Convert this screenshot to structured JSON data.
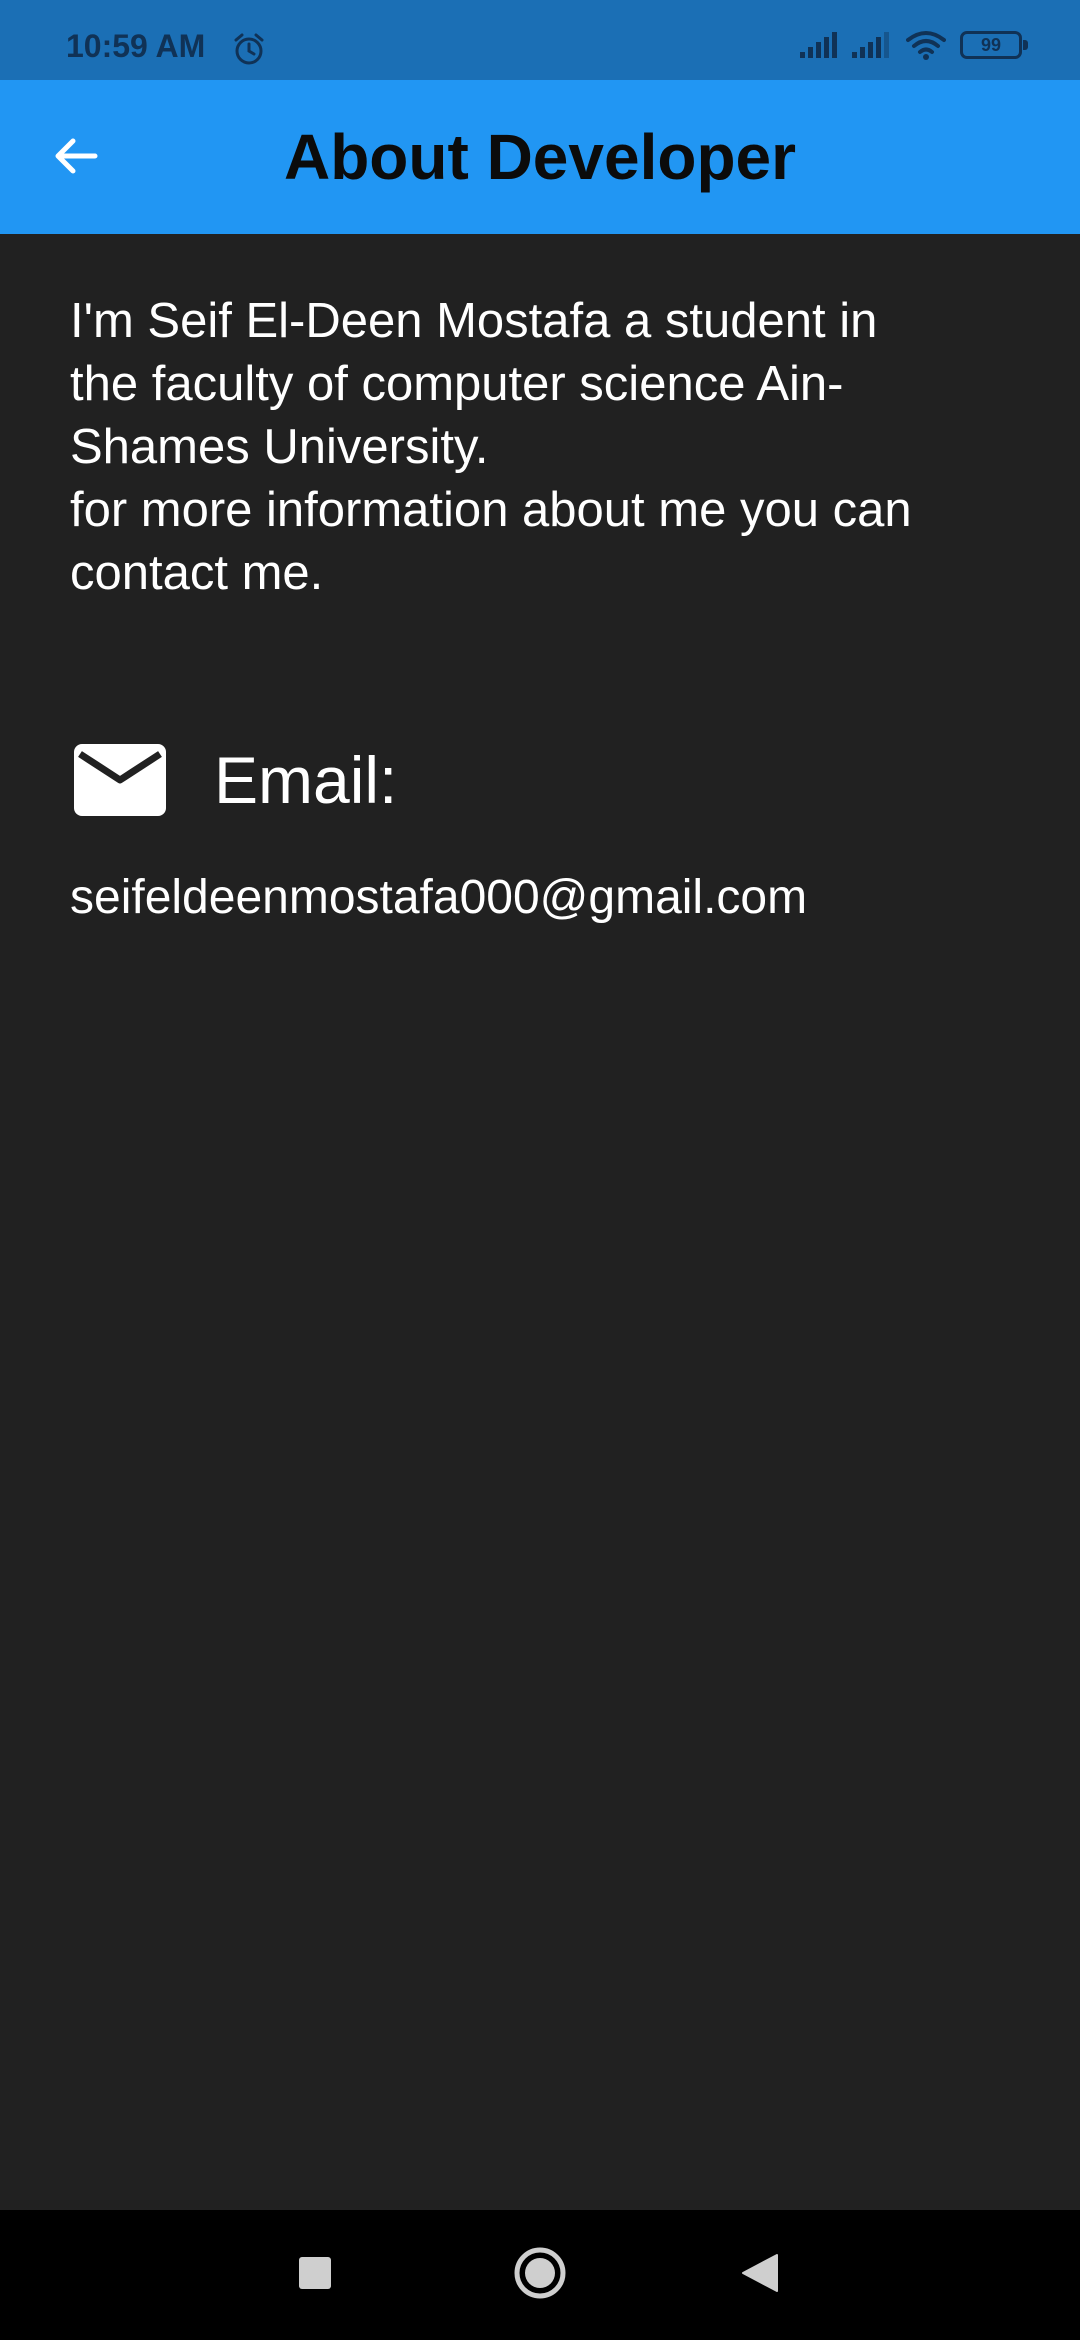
{
  "status_bar": {
    "time": "10:59 AM",
    "alarm_icon": "alarm-clock-icon",
    "signal_icons": [
      "signal-icon",
      "signal-icon"
    ],
    "wifi_icon": "wifi-icon",
    "battery_level": "99"
  },
  "app_bar": {
    "back_icon": "arrow-back-icon",
    "title": "About Developer",
    "color": "#2196f3"
  },
  "bio": {
    "lines": [
      "I'm Seif El-Deen Mostafa a student in",
      "the faculty of computer science Ain-",
      "Shames University.",
      "for more information about me you can",
      "contact me."
    ]
  },
  "email": {
    "icon": "mail-icon",
    "label": "Email:",
    "address": "seifeldeenmostafa000@gmail.com"
  },
  "nav_bar": {
    "buttons": [
      "recents-square-icon",
      "home-circle-icon",
      "back-triangle-icon"
    ]
  },
  "colors": {
    "background": "#212121",
    "status_bar": "#1b6fb5",
    "text": "#ffffff"
  }
}
